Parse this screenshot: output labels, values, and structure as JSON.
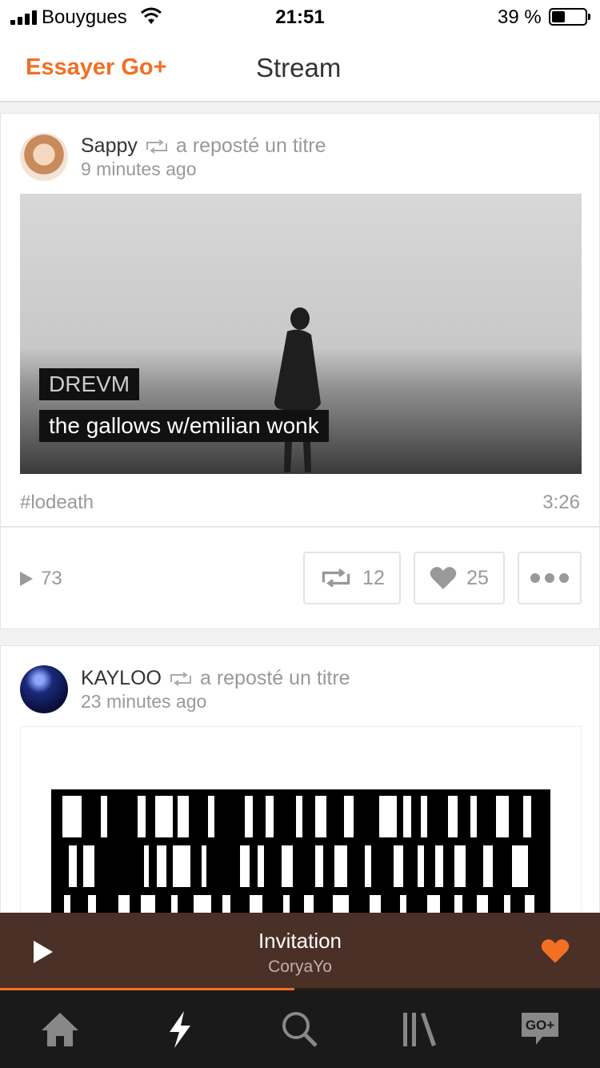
{
  "status_bar": {
    "carrier": "Bouygues",
    "time": "21:51",
    "battery_percent": "39 %",
    "battery_level": 0.39
  },
  "header": {
    "try_go_label": "Essayer Go+",
    "title": "Stream"
  },
  "feed": [
    {
      "user": "Sappy",
      "action": "a reposté un titre",
      "time_ago": "9 minutes ago",
      "artist": "DREVM",
      "track": "the gallows w/emilian wonk",
      "tag": "#lodeath",
      "duration": "3:26",
      "plays": "73",
      "reposts": "12",
      "likes": "25"
    },
    {
      "user": "KAYLOO",
      "action": "a reposté un titre",
      "time_ago": "23 minutes ago"
    }
  ],
  "player": {
    "title": "Invitation",
    "artist": "CoryaYo",
    "progress": 0.49,
    "accent": "#f26f23",
    "background": "#4a3026"
  },
  "tabbar": {
    "icons": [
      "home-icon",
      "stream-icon",
      "search-icon",
      "library-icon",
      "go-plus-icon"
    ],
    "go_label": "GO+"
  }
}
